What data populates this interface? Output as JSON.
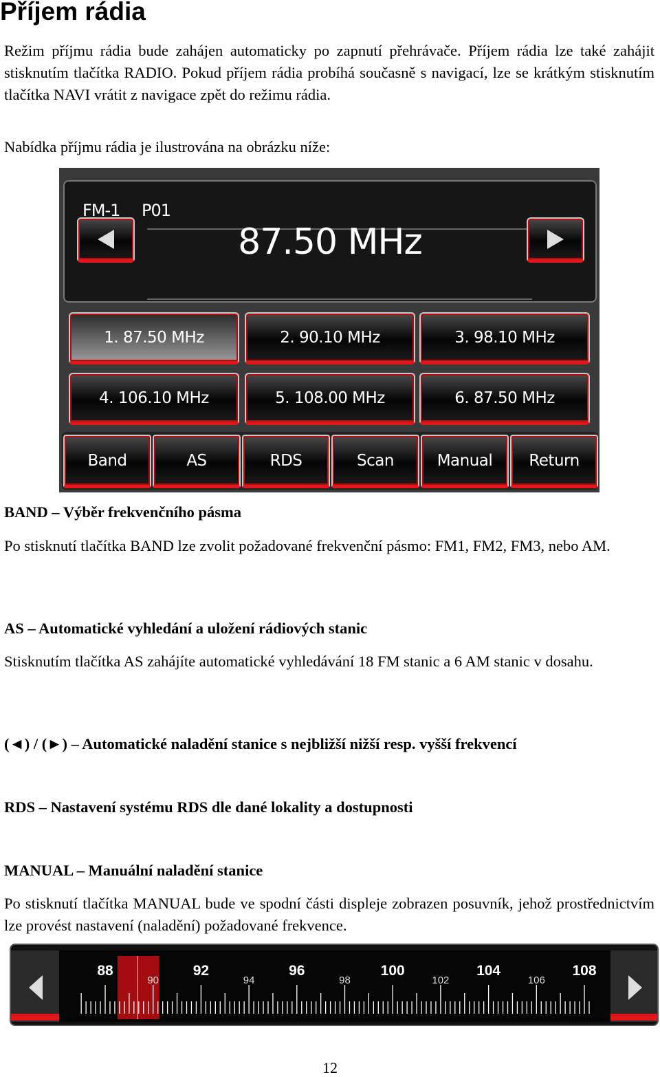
{
  "title": "Příjem rádia",
  "intro": "Režim příjmu rádia bude zahájen automaticky po zapnutí přehrávače. Příjem rádia lze také zahájit stisknutím tlačítka RADIO. Pokud příjem rádia probíhá současně s navigací, lze se krátkým stisknutím tlačítka NAVI vrátit z navigace zpět do režimu rádia.",
  "menu_caption": "Nabídka příjmu rádia je ilustrována na obrázku níže:",
  "radio": {
    "band": "FM-1",
    "preset": "P01",
    "frequency": "87.50 MHz",
    "prev_icon": "triangle-left-icon",
    "next_icon": "triangle-right-icon",
    "presets": [
      "1.  87.50 MHz",
      "2.  90.10 MHz",
      "3.  98.10 MHz",
      "4. 106.10 MHz",
      "5. 108.00 MHz",
      "6.  87.50 MHz"
    ],
    "selected_preset": 0,
    "buttons": [
      "Band",
      "AS",
      "RDS",
      "Scan",
      "Manual",
      "Return"
    ],
    "accent": "#e0171a"
  },
  "sections": [
    {
      "heading": "BAND – Výběr frekvenčního pásma",
      "text": "Po stisknutí tlačítka BAND lze zvolit požadované frekvenční pásmo: FM1, FM2, FM3, nebo AM."
    },
    {
      "heading": "AS – Automatické vyhledání a uložení rádiových stanic",
      "text": "Stisknutím tlačítka AS zahájíte automatické vyhledávání 18 FM stanic a 6 AM stanic v dosahu."
    },
    {
      "heading": "(◄) / (►) – Automatické naladění stanice s nejbližší nižší resp. vyšší frekvencí"
    },
    {
      "heading": "RDS – Nastavení systému RDS dle dané lokality a dostupnosti"
    },
    {
      "heading": "MANUAL – Manuální naladění stanice",
      "text": "Po stisknutí tlačítka MANUAL bude ve spodní části displeje zobrazen posuvník, jehož prostřednictvím lze provést nastavení (naladění) požadované frekvence."
    }
  ],
  "slider": {
    "major_labels": [
      "88",
      "92",
      "96",
      "100",
      "104",
      "108"
    ],
    "minor_labels": [
      "90",
      "94",
      "98",
      "102",
      "106"
    ],
    "range_mhz": [
      87,
      108.2
    ],
    "selected_mhz": 89.4
  },
  "page_number": "12"
}
